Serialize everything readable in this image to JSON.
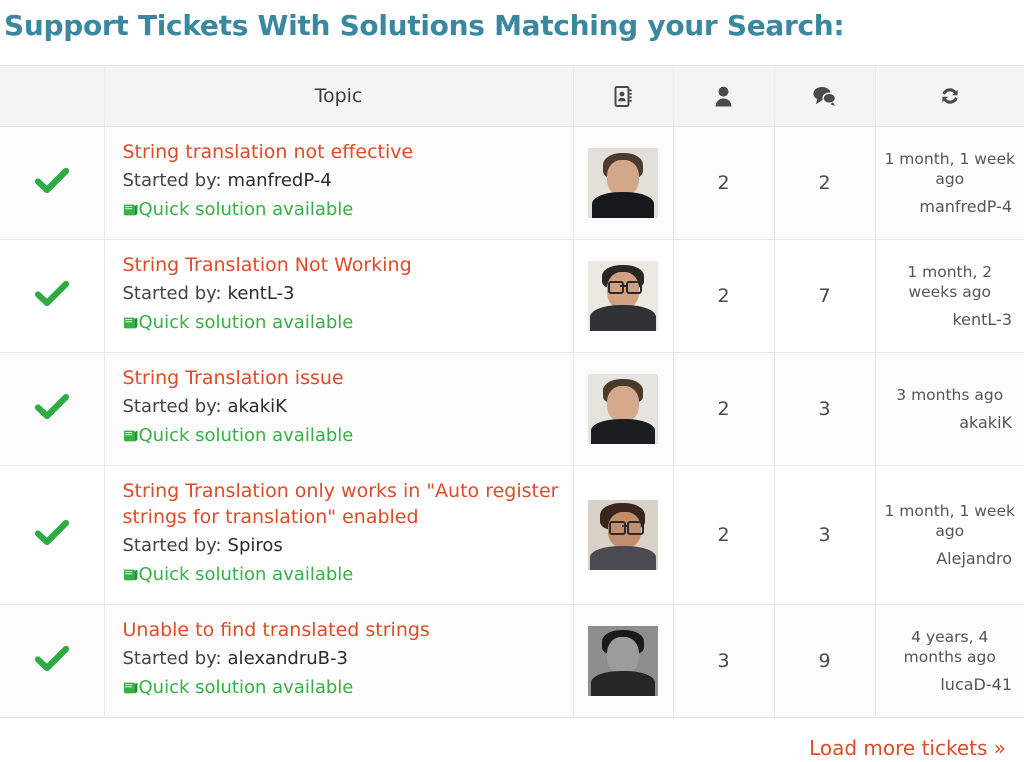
{
  "page": {
    "title": "Support Tickets With Solutions Matching your Search:",
    "title_color": "#3a87a0"
  },
  "table": {
    "columns": {
      "status": {
        "label": "",
        "icon": ""
      },
      "topic": {
        "label": "Topic"
      },
      "avatar": {
        "label": "",
        "icon": "address-book-icon"
      },
      "voices": {
        "label": "",
        "icon": "user-icon"
      },
      "posts": {
        "label": "",
        "icon": "comments-icon"
      },
      "freshness": {
        "label": "",
        "icon": "refresh-icon"
      }
    },
    "started_by_label": "Started by:",
    "quick_solution_label": "Quick solution available",
    "status_icon": "green-check-icon",
    "link_color": "#dd4b28",
    "solution_color": "#35b045",
    "rows": [
      {
        "topic": "String translation not effective",
        "author": "manfredP-4",
        "quick_solution": "Quick solution available",
        "avatar": "avatar-manfredp-4",
        "voices": "2",
        "posts": "2",
        "freshness_time": "1 month, 1 week ago",
        "freshness_author": "manfredP-4"
      },
      {
        "topic": "String Translation Not Working",
        "author": "kentL-3",
        "quick_solution": "Quick solution available",
        "avatar": "avatar-kentl-3",
        "voices": "2",
        "posts": "7",
        "freshness_time": "1 month, 2 weeks ago",
        "freshness_author": "kentL-3"
      },
      {
        "topic": "String Translation issue",
        "author": "akakiK",
        "quick_solution": "Quick solution available",
        "avatar": "avatar-akakik",
        "voices": "2",
        "posts": "3",
        "freshness_time": "3 months ago",
        "freshness_author": "akakiK"
      },
      {
        "topic": "String Translation only works in \"Auto register strings for translation\" enabled",
        "author": "Spiros",
        "quick_solution": "Quick solution available",
        "avatar": "avatar-spiros",
        "voices": "2",
        "posts": "3",
        "freshness_time": "1 month, 1 week ago",
        "freshness_author": "Alejandro"
      },
      {
        "topic": "Unable to find translated strings",
        "author": "alexandruB-3",
        "quick_solution": "Quick solution available",
        "avatar": "avatar-alexandrub-3",
        "voices": "3",
        "posts": "9",
        "freshness_time": "4 years, 4 months ago",
        "freshness_author": "lucaD-41"
      }
    ]
  },
  "footer": {
    "load_more_label": "Load more tickets »"
  }
}
